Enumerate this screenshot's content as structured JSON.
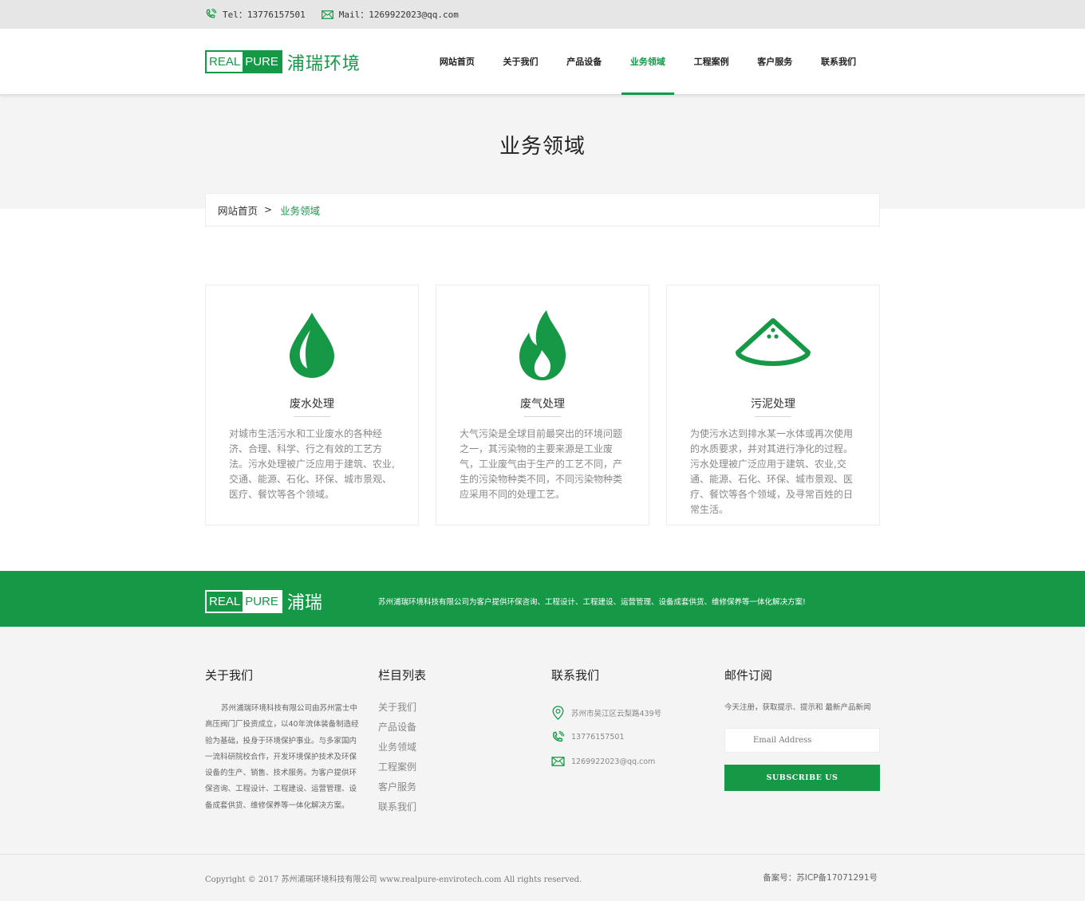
{
  "topbar": {
    "tel_label": "Tel：",
    "tel": "13776157501",
    "mail_label": "Mail：",
    "mail": "1269922023@qq.com"
  },
  "brand": {
    "real": "REAL",
    "pure": "PURE",
    "cn_name": "浦瑞环境",
    "cn_short": "浦瑞",
    "color": "#159947"
  },
  "nav": {
    "items": [
      "网站首页",
      "关于我们",
      "产品设备",
      "业务领域",
      "工程案例",
      "客户服务",
      "联系我们"
    ],
    "active": "业务领域"
  },
  "banner": {
    "title": "业务领域"
  },
  "breadcrumb": {
    "home": "网站首页",
    "separator": ">",
    "current": "业务领域"
  },
  "cards": [
    {
      "icon": "water-drop-icon",
      "title": "废水处理",
      "text": "对城市生活污水和工业废水的各种经济、合理、科学、行之有效的工艺方法。污水处理被广泛应用于建筑、农业,交通、能源、石化、环保、城市景观、医疗、餐饮等各个领域。"
    },
    {
      "icon": "flame-icon",
      "title": "废气处理",
      "text": "大气污染是全球目前最突出的环境问题之一，其污染物的主要来源是工业废气，工业废气由于生产的工艺不同，产生的污染物种类不同，不同污染物种类应采用不同的处理工艺。"
    },
    {
      "icon": "sludge-pile-icon",
      "title": "污泥处理",
      "text": "为使污水达到排水某一水体或再次使用的水质要求，并对其进行净化的过程。污水处理被广泛应用于建筑、农业,交通、能源、石化、环保、城市景观、医疗、餐饮等各个领域，及寻常百姓的日常生活。"
    }
  ],
  "band": {
    "slogan": "苏州浦瑞环境科技有限公司为客户提供环保咨询、工程设计、工程建设、运营管理、设备成套供货、维修保养等一体化解决方案!"
  },
  "footer": {
    "about": {
      "heading": "关于我们",
      "text": "苏州浦瑞环境科技有限公司由苏州富士中高压阀门厂投资成立，以40年流体装备制造经验为基础，投身于环境保护事业。与多家国内一流科研院校合作，开发环境保护技术及环保设备的生产、销售、技术服务。为客户提供环保咨询、工程设计、工程建设、运营管理、设备成套供货、维修保养等一体化解决方案。"
    },
    "links": {
      "heading": "栏目列表",
      "items": [
        "关于我们",
        "产品设备",
        "业务领域",
        "工程案例",
        "客户服务",
        "联系我们"
      ]
    },
    "contact": {
      "heading": "联系我们",
      "address": "苏州市吴江区云梨路439号",
      "phone": "13776157501",
      "email": "1269922023@qq.com"
    },
    "subscribe": {
      "heading": "邮件订阅",
      "desc": "今天注册，获取提示、提示和 最新产品新闻",
      "placeholder": "Email Address",
      "button": "SUBSCRIBE US"
    }
  },
  "copyright": {
    "text": "Copyright © 2017 苏州浦瑞环境科技有限公司 www.realpure-envirotech.com All rights reserved.",
    "icp": "备案号：苏ICP备17071291号"
  }
}
